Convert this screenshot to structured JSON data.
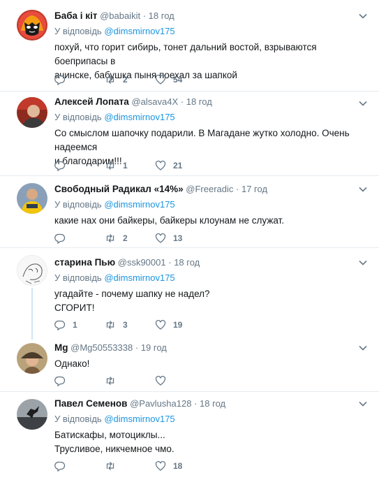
{
  "tweets": [
    {
      "name": "Баба і кіт",
      "handle": "@babaikit",
      "dot": "·",
      "time": "18 год",
      "reply_prefix": "У відповідь",
      "reply_to": "@dimsmirnov175",
      "lines": [
        "похуй, что горит сибирь, тонет дальний востой, взрываются боеприпасы в",
        "ачинске, бабушка пыня поехал за шапкой"
      ],
      "replies": "",
      "retweets": "2",
      "likes": "54",
      "avatar": "mask"
    },
    {
      "name": "Алексей Лопата",
      "handle": "@alsava4X",
      "dot": "·",
      "time": "18 год",
      "reply_prefix": "У відповідь",
      "reply_to": "@dimsmirnov175",
      "lines": [
        "Со смыслом шапочку подарили. В Магадане жутко холодно. Очень надеемся",
        "и благодарим!!!"
      ],
      "replies": "",
      "retweets": "1",
      "likes": "21",
      "avatar": "person-red"
    },
    {
      "name": "Свободный Радикал «14%»",
      "handle": "@Freeradic",
      "dot": "·",
      "time": "17 год",
      "reply_prefix": "У відповідь",
      "reply_to": "@dimsmirnov175",
      "lines": [
        "какие нах они байкеры, байкеры клоунам не служат."
      ],
      "replies": "",
      "retweets": "2",
      "likes": "13",
      "avatar": "person-yellow"
    },
    {
      "name": "старина Пью",
      "handle": "@ssk90001",
      "dot": "·",
      "time": "18 год",
      "reply_prefix": "У відповідь",
      "reply_to": "@dimsmirnov175",
      "lines": [
        "угадайте - почему шапку не надел?",
        "СГОРИТ!"
      ],
      "replies": "1",
      "retweets": "3",
      "likes": "19",
      "avatar": "sketch"
    },
    {
      "name": "Mg",
      "handle": "@Mg50553338",
      "dot": "·",
      "time": "19 год",
      "reply_prefix": "",
      "reply_to": "",
      "lines": [
        "Однако!"
      ],
      "replies": "",
      "retweets": "",
      "likes": "",
      "avatar": "person-hat"
    },
    {
      "name": "Павел Семенов",
      "handle": "@Pavlusha128",
      "dot": "·",
      "time": "18 год",
      "reply_prefix": "У відповідь",
      "reply_to": "@dimsmirnov175",
      "lines": [
        "Батискафы, мотоциклы...",
        "Трусливое, никчемное чмо."
      ],
      "replies": "",
      "retweets": "",
      "likes": "18",
      "avatar": "silhouette"
    }
  ],
  "colors": {
    "accent": "#1b95e0",
    "muted": "#657786",
    "text": "#14171a",
    "separator": "#e6ecf0"
  },
  "icons": [
    "reply-icon",
    "retweet-icon",
    "like-icon",
    "chevron-down-icon"
  ]
}
